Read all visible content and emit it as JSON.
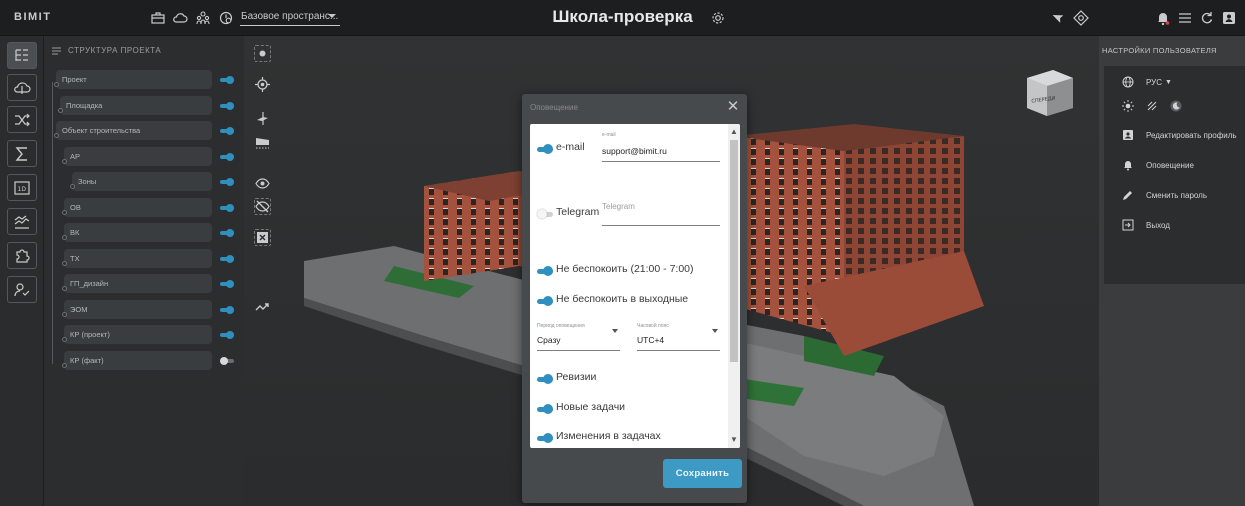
{
  "app": {
    "logo": "BIMIT",
    "space_selector": "Базовое пространс...",
    "project_title": "Школа-проверка"
  },
  "structure": {
    "header": "СТРУКТУРА ПРОЕКТА",
    "items": [
      {
        "label": "Проект",
        "on": true
      },
      {
        "label": "Площадка",
        "on": true
      },
      {
        "label": "Объект строительства",
        "on": true
      },
      {
        "label": "АР",
        "on": true
      },
      {
        "label": "Зоны",
        "on": true
      },
      {
        "label": "ОВ",
        "on": true
      },
      {
        "label": "ВК",
        "on": true
      },
      {
        "label": "ТХ",
        "on": true
      },
      {
        "label": "ГП_дизайн",
        "on": true
      },
      {
        "label": "ЭОМ",
        "on": true
      },
      {
        "label": "КР (проект)",
        "on": true
      },
      {
        "label": "КР (факт)",
        "on": false
      }
    ]
  },
  "viewcube_label": "СПЕРЕДИ",
  "user_settings": {
    "header": "НАСТРОЙКИ ПОЛЬЗОВАТЕЛЯ",
    "language": "РУС",
    "edit_profile": "Редактировать профиль",
    "notifications": "Оповещение",
    "change_password": "Сменить пароль",
    "logout": "Выход"
  },
  "modal": {
    "title": "Оповещение",
    "email_toggle_label": "e-mail",
    "email_field_label": "e-mail",
    "email_value": "support@bimit.ru",
    "telegram_toggle_label": "Telegram",
    "telegram_placeholder": "Telegram",
    "dnd_night": "Не беспокоить (21:00 - 7:00)",
    "dnd_weekend": "Не беспокоить в выходные",
    "period_label": "Период оповещения",
    "period_value": "Сразу",
    "tz_label": "Часовой пояс",
    "tz_value": "UTC+4",
    "revisions": "Ревизии",
    "new_tasks": "Новые задачи",
    "task_changes": "Изменения в задачах",
    "save": "Сохранить"
  },
  "colors": {
    "accent": "#3c9ac4",
    "toggle_on": "#2f8fbe",
    "bell_alert": "#e23b3b"
  }
}
